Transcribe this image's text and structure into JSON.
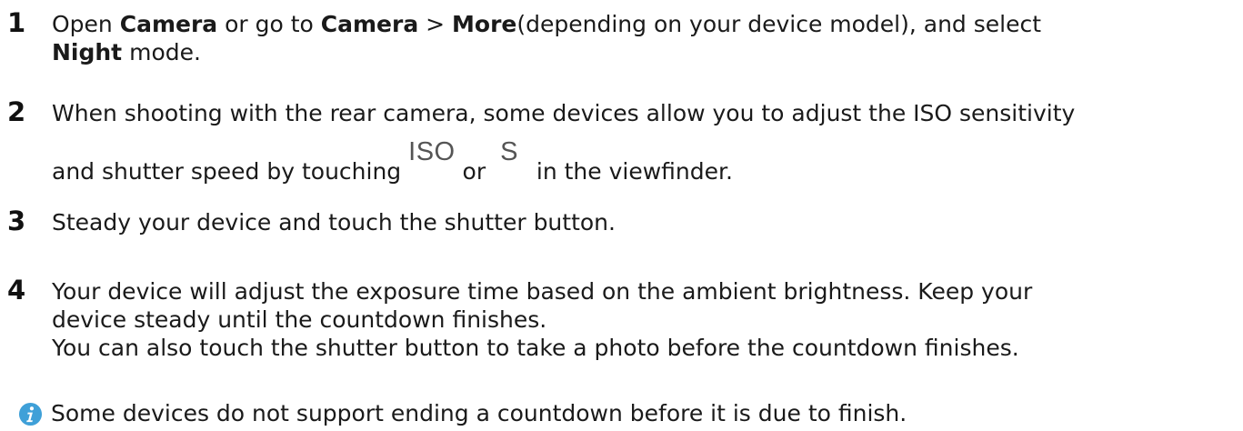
{
  "steps": [
    {
      "number": "1",
      "lines": [
        {
          "t1": "Open ",
          "b1": "Camera",
          "t2": " or go to ",
          "b2": "Camera",
          "t3": " > ",
          "b3": "More",
          "t4": "(depending on your device model), and select"
        },
        {
          "b1": "Night",
          "t1": " mode."
        }
      ]
    },
    {
      "number": "2",
      "lines": [
        {
          "text": "When shooting with the rear camera, some devices allow you to adjust the ISO sensitivity"
        },
        {
          "t1": "and shutter speed by touching ",
          "icon1": "ISO",
          "t2": " or ",
          "icon2": "S",
          "t3": " in the viewfinder."
        }
      ]
    },
    {
      "number": "3",
      "lines": [
        {
          "text": "Steady your device and touch the shutter button."
        }
      ]
    },
    {
      "number": "4",
      "lines": [
        {
          "text": "Your device will adjust the exposure time based on the ambient brightness. Keep your"
        },
        {
          "text": "device steady until the countdown finishes."
        },
        {
          "text": "You can also touch the shutter button to take a photo before the countdown finishes."
        }
      ]
    }
  ],
  "note": {
    "icon": "info-icon",
    "text": "Some devices do not support ending a countdown before it is due to finish.",
    "icon_color": "#3fa0d8"
  }
}
